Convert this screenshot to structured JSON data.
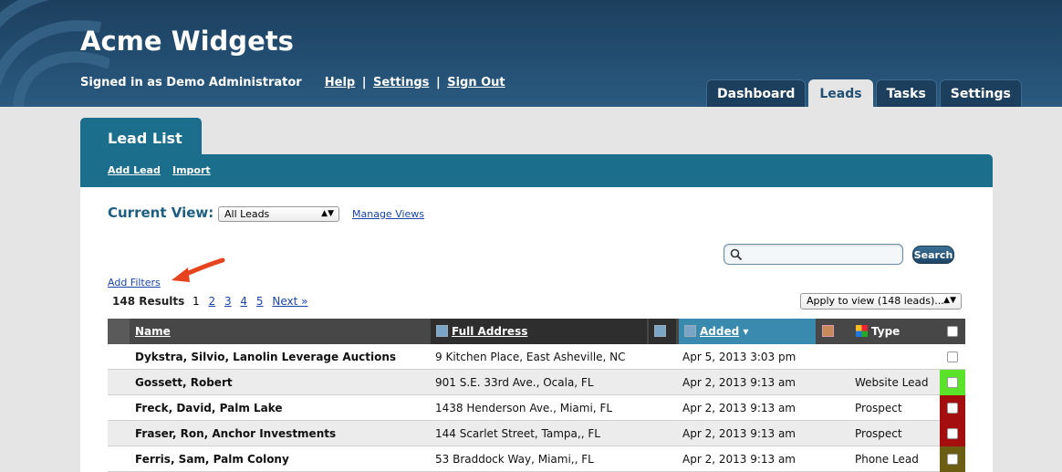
{
  "app": {
    "title": "Acme Widgets",
    "signed_in": "Signed in as Demo Administrator",
    "links": {
      "help": "Help",
      "settings": "Settings",
      "sign_out": "Sign Out"
    },
    "separator": "|"
  },
  "nav": {
    "tabs": [
      {
        "label": "Dashboard",
        "active": false
      },
      {
        "label": "Leads",
        "active": true
      },
      {
        "label": "Tasks",
        "active": false
      },
      {
        "label": "Settings",
        "active": false
      }
    ]
  },
  "page": {
    "tab_title": "Lead List",
    "actions": {
      "add_lead": "Add Lead",
      "import": "Import"
    },
    "current_view_label": "Current View:",
    "current_view_value": "All Leads",
    "manage_views": "Manage Views",
    "search_placeholder": "",
    "search_button": "Search",
    "add_filters": "Add Filters",
    "results": "148 Results",
    "pagination": {
      "current": "1",
      "pages": [
        "2",
        "3",
        "4",
        "5"
      ],
      "next": "Next »"
    },
    "apply_to_view": "Apply to view (148 leads)..."
  },
  "table": {
    "headers": {
      "name": "Name",
      "address": "Full Address",
      "added": "Added",
      "sort_indicator": "▾",
      "type": "Type"
    },
    "rows": [
      {
        "name": "Dykstra, Silvio, Lanolin Leverage Auctions",
        "address": "9 Kitchen Place, East Asheville, NC",
        "added": "Apr 5, 2013 3:03 pm",
        "type": "",
        "color": "#ffffff"
      },
      {
        "name": "Gossett, Robert",
        "address": "901 S.E. 33rd Ave., Ocala, FL",
        "added": "Apr 2, 2013 9:13 am",
        "type": "Website Lead",
        "color": "#5be32a"
      },
      {
        "name": "Freck, David, Palm Lake",
        "address": "1438 Henderson Ave., Miami, FL",
        "added": "Apr 2, 2013 9:13 am",
        "type": "Prospect",
        "color": "#a50e0e"
      },
      {
        "name": "Fraser, Ron, Anchor Investments",
        "address": "144 Scarlet Street, Tampa,, FL",
        "added": "Apr 2, 2013 9:13 am",
        "type": "Prospect",
        "color": "#a50e0e"
      },
      {
        "name": "Ferris, Sam, Palm Colony",
        "address": "53 Braddock Way, Miami,, FL",
        "added": "Apr 2, 2013 9:13 am",
        "type": "Phone Lead",
        "color": "#6b5e12"
      }
    ]
  },
  "icons": {
    "arrow": "red-arrow-icon",
    "search": "magnifier-icon",
    "column": "asterisk-icon",
    "person": "person-icon",
    "type": "color-grid-icon"
  }
}
